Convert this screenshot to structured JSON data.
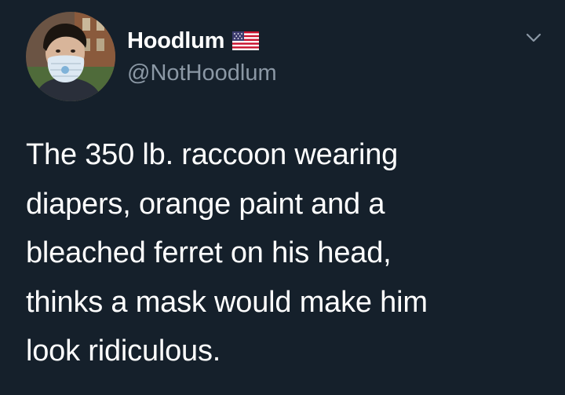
{
  "tweet": {
    "author": {
      "display_name": "Hoodlum",
      "handle": "@NotHoodlum",
      "flag_icon": "us-flag-icon",
      "avatar_icon": "profile-photo-masked-man"
    },
    "menu_icon": "chevron-down-icon",
    "text": "The 350 lb. raccoon wearing\ndiapers, orange paint and a\nbleached ferret on his head,\nthinks a mask would make him\nlook ridiculous."
  },
  "colors": {
    "background": "#15202b",
    "text_primary": "#ffffff",
    "text_secondary": "#8b98a5"
  }
}
